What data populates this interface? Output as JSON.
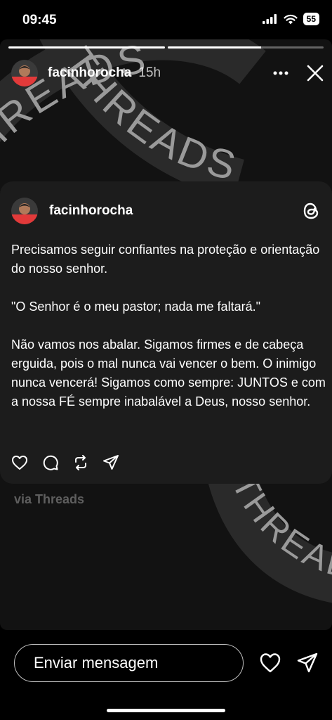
{
  "status_bar": {
    "time": "09:45",
    "battery": "55",
    "icons": [
      "signal-icon",
      "wifi-icon",
      "battery-icon"
    ]
  },
  "story": {
    "progress": [
      1.0,
      0.6
    ],
    "username": "facinhorocha",
    "time_ago": "15h",
    "background_word": "THREADS",
    "header_icons": [
      "more-icon",
      "close-icon"
    ]
  },
  "post": {
    "username": "facinhorocha",
    "paragraphs": [
      "Precisamos seguir confiantes na proteção e orientação do nosso senhor.",
      "\"O Senhor é o meu pastor; nada me faltará.\"",
      "Não vamos nos abalar. Sigamos firmes e de cabeça erguida, pois o mal nunca vai vencer o bem. O inimigo nunca vencerá! Sigamos como sempre: JUNTOS e com a nossa FÉ sempre inabalável a Deus, nosso senhor."
    ],
    "action_icons": [
      "heart-icon",
      "comment-icon",
      "repost-icon",
      "share-icon"
    ],
    "via": "via Threads"
  },
  "bottom": {
    "message_placeholder": "Enviar mensagem",
    "icons": [
      "heart-icon",
      "send-icon"
    ]
  },
  "colors": {
    "background": "#000000",
    "card": "#1c1c1c",
    "story_bg": "#121212",
    "via_text": "#5e5e5e"
  }
}
